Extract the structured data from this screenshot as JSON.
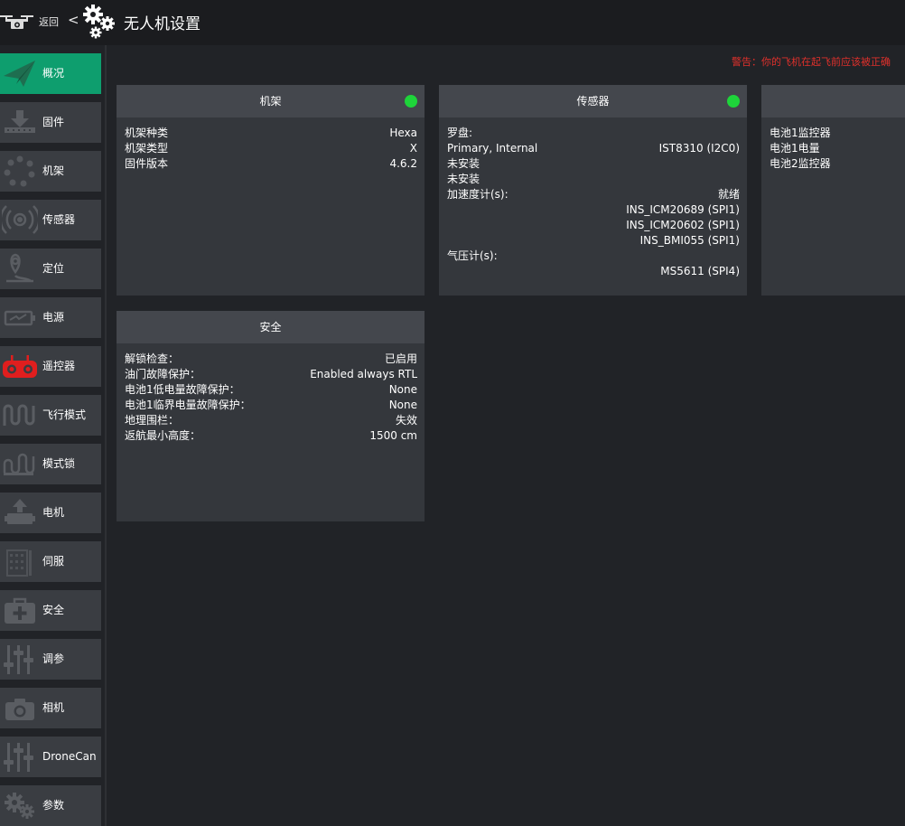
{
  "header": {
    "back_label": "返回",
    "chevron": "<",
    "title": "无人机设置",
    "icons": {
      "drone": "drone-icon",
      "gears": "gears-icon"
    }
  },
  "sidebar": {
    "items": [
      {
        "label": "概况",
        "icon": "paper-plane-icon",
        "active": true
      },
      {
        "label": "固件",
        "icon": "firmware-download-icon"
      },
      {
        "label": "机架",
        "icon": "airframe-dots-icon"
      },
      {
        "label": "传感器",
        "icon": "sensor-waves-icon"
      },
      {
        "label": "定位",
        "icon": "location-pin-icon"
      },
      {
        "label": "电源",
        "icon": "battery-icon"
      },
      {
        "label": "遥控器",
        "icon": "rc-controller-icon"
      },
      {
        "label": "飞行模式",
        "icon": "flight-mode-wave-icon"
      },
      {
        "label": "模式锁",
        "icon": "mode-lock-wave-icon"
      },
      {
        "label": "电机",
        "icon": "motor-icon"
      },
      {
        "label": "伺服",
        "icon": "servo-icon"
      },
      {
        "label": "安全",
        "icon": "first-aid-icon"
      },
      {
        "label": "调参",
        "icon": "sliders-icon"
      },
      {
        "label": "相机",
        "icon": "camera-icon"
      },
      {
        "label": "DroneCan",
        "icon": "sliders-icon"
      },
      {
        "label": "参数",
        "icon": "gears-icon"
      }
    ]
  },
  "warning": "警告：你的飞机在起飞前应该被正确",
  "cards": {
    "airframe": {
      "title": "机架",
      "rows": [
        {
          "key": "机架种类",
          "value": "Hexa"
        },
        {
          "key": "机架类型",
          "value": "X"
        },
        {
          "key": "固件版本",
          "value": "4.6.2"
        }
      ]
    },
    "sensors": {
      "title": "传感器",
      "rows": [
        {
          "key": "罗盘:",
          "value": ""
        },
        {
          "key": "Primary, Internal",
          "value": "IST8310 (I2C0)"
        },
        {
          "key": "未安装",
          "value": ""
        },
        {
          "key": "未安装",
          "value": ""
        },
        {
          "key": "加速度计(s):",
          "value": "就绪"
        },
        {
          "key": "",
          "value": "INS_ICM20689 (SPI1)"
        },
        {
          "key": "",
          "value": "INS_ICM20602 (SPI1)"
        },
        {
          "key": "",
          "value": "INS_BMI055 (SPI1)"
        },
        {
          "key": "气压计(s):",
          "value": ""
        },
        {
          "key": "",
          "value": "MS5611 (SPI4)"
        }
      ]
    },
    "power": {
      "rows": [
        {
          "key": "电池1监控器",
          "value": ""
        },
        {
          "key": "电池1电量",
          "value": ""
        },
        {
          "key": "电池2监控器",
          "value": ""
        }
      ]
    },
    "safety": {
      "title": "安全",
      "rows": [
        {
          "key": "解锁检查：",
          "value": "已启用"
        },
        {
          "key": "油门故障保护：",
          "value": "Enabled always RTL"
        },
        {
          "key": "电池1低电量故障保护：",
          "value": "None"
        },
        {
          "key": "电池1临界电量故障保护：",
          "value": "None"
        },
        {
          "key": "地理围栏：",
          "value": "失效"
        },
        {
          "key": "返航最小高度：",
          "value": "1500 cm"
        }
      ]
    }
  },
  "colors": {
    "accent": "#0e9e6e",
    "status_ok": "#1ed43a",
    "warning": "#e0302b",
    "rc_icon": "#e01e1e"
  }
}
